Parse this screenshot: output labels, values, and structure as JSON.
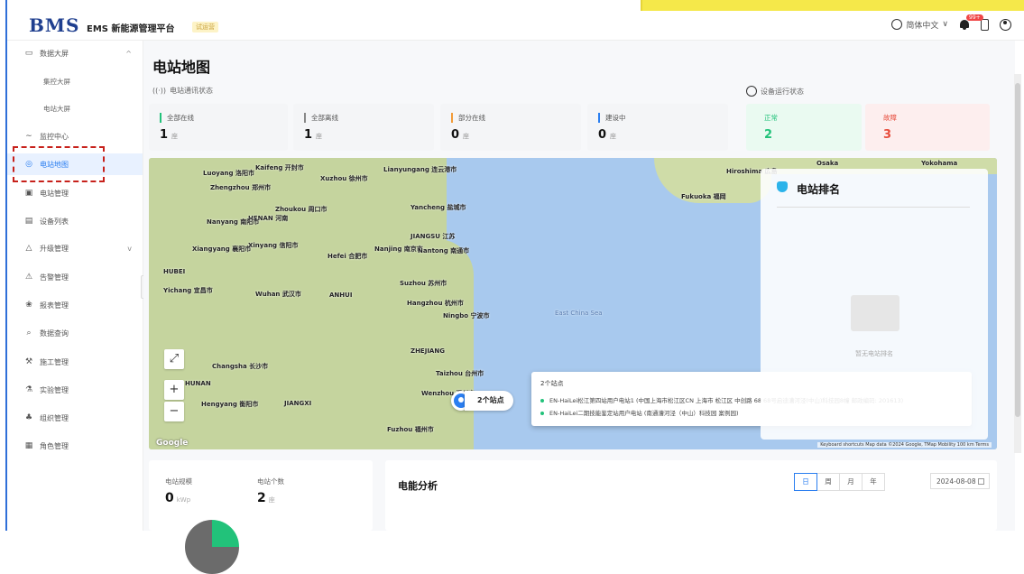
{
  "header": {
    "logo": "BMS",
    "platform_name": "EMS 新能源管理平台",
    "version_badge": "试运营",
    "language": "简体中文",
    "notice_count": "99+"
  },
  "sidebar": {
    "items": [
      {
        "label": "数据大屏",
        "icon": "monitor-icon",
        "caret": "^"
      },
      {
        "label": "集控大屏"
      },
      {
        "label": "电站大屏"
      },
      {
        "label": "监控中心",
        "icon": "trend-icon"
      },
      {
        "label": "电站地图",
        "icon": "location-icon"
      },
      {
        "label": "电站管理",
        "icon": "station-icon"
      },
      {
        "label": "设备列表",
        "icon": "device-icon"
      },
      {
        "label": "升级管理",
        "icon": "upgrade-icon",
        "caret": "v"
      },
      {
        "label": "告警管理",
        "icon": "alarm-icon"
      },
      {
        "label": "报表管理",
        "icon": "report-icon"
      },
      {
        "label": "数据查询",
        "icon": "query-icon"
      },
      {
        "label": "施工管理",
        "icon": "construction-icon"
      },
      {
        "label": "实验管理",
        "icon": "experiment-icon"
      },
      {
        "label": "组织管理",
        "icon": "org-icon"
      },
      {
        "label": "角色管理",
        "icon": "role-icon"
      }
    ]
  },
  "main": {
    "title": "电站地图",
    "comm_status_label": "电站通讯状态",
    "run_status_label": "设备运行状态",
    "cards": [
      {
        "label": "全部在线",
        "value": "1",
        "unit": "座",
        "color": "#22c27a"
      },
      {
        "label": "全部离线",
        "value": "1",
        "unit": "座",
        "color": "#888888"
      },
      {
        "label": "部分在线",
        "value": "0",
        "unit": "座",
        "color": "#f29b38"
      },
      {
        "label": "建设中",
        "value": "0",
        "unit": "座",
        "color": "#2a7ef0"
      }
    ],
    "run_cards": [
      {
        "label": "正常",
        "value": "2",
        "color": "#22c27a"
      },
      {
        "label": "故障",
        "value": "3",
        "color": "#e74c3c"
      }
    ]
  },
  "map": {
    "cluster_label": "2个站点",
    "tooltip_title": "2个站点",
    "stations": [
      {
        "text": "EN-HaiLei松江第四站用户电站1 (中国上海市松江区CN 上海市 松江区 中创路 68 68号启迪漕河泾(中山)科技园8幢 邮政编码: 201613)",
        "color": "#22c27a"
      },
      {
        "text": "EN-HaiLei二期技能鉴定站用户电站 (南通漕河泾（中山）科技园 案例园)",
        "color": "#22c27a"
      }
    ],
    "attribution": "Keyboard shortcuts  Map data ©2024 Google, TMap Mobility  100 km  Terms",
    "google": "Google",
    "labels": [
      {
        "text": "Luoyang 洛阳市"
      },
      {
        "text": "Zhengzhou 郑州市"
      },
      {
        "text": "Kaifeng 开封市"
      },
      {
        "text": "Xuzhou 徐州市"
      },
      {
        "text": "Lianyungang 连云港市"
      },
      {
        "text": "Yancheng 盐城市"
      },
      {
        "text": "Zhoukou 周口市"
      },
      {
        "text": "HENAN 河南"
      },
      {
        "text": "Nanyang 南阳市"
      },
      {
        "text": "JIANGSU 江苏"
      },
      {
        "text": "Xiangyang 襄阳市"
      },
      {
        "text": "Xinyang 信阳市"
      },
      {
        "text": "Hefei 合肥市"
      },
      {
        "text": "Nanjing 南京市"
      },
      {
        "text": "Nantong 南通市"
      },
      {
        "text": "HUBEI"
      },
      {
        "text": "Suzhou 苏州市"
      },
      {
        "text": "Yichang 宜昌市"
      },
      {
        "text": "Wuhan 武汉市"
      },
      {
        "text": "ANHUI"
      },
      {
        "text": "Hangzhou 杭州市"
      },
      {
        "text": "Ningbo 宁波市"
      },
      {
        "text": "Changsha 长沙市"
      },
      {
        "text": "ZHEJIANG"
      },
      {
        "text": "HUNAN"
      },
      {
        "text": "Taizhou 台州市"
      },
      {
        "text": "Wenzhou 温州市"
      },
      {
        "text": "Hengyang 衡阳市"
      },
      {
        "text": "JIANGXI"
      },
      {
        "text": "Fuzhou 福州市"
      },
      {
        "text": "Hiroshima 広島"
      },
      {
        "text": "Fukuoka 福岡"
      },
      {
        "text": "Osaka"
      },
      {
        "text": "Yokohama"
      },
      {
        "text": "East China Sea"
      }
    ]
  },
  "ranking": {
    "title": "电站排名",
    "empty_text": "暂无电站排名"
  },
  "bottom": {
    "scale_label": "电站规模",
    "scale_value": "0",
    "scale_unit": "kWp",
    "count_label": "电站个数",
    "count_value": "2",
    "count_unit": "座",
    "energy_title": "电能分析",
    "tabs": [
      "日",
      "周",
      "月",
      "年"
    ],
    "date": "2024-08-08"
  },
  "colors": {
    "accent": "#2a7ef0",
    "brand": "#1f3f8f",
    "highlight": "#c7211b"
  }
}
